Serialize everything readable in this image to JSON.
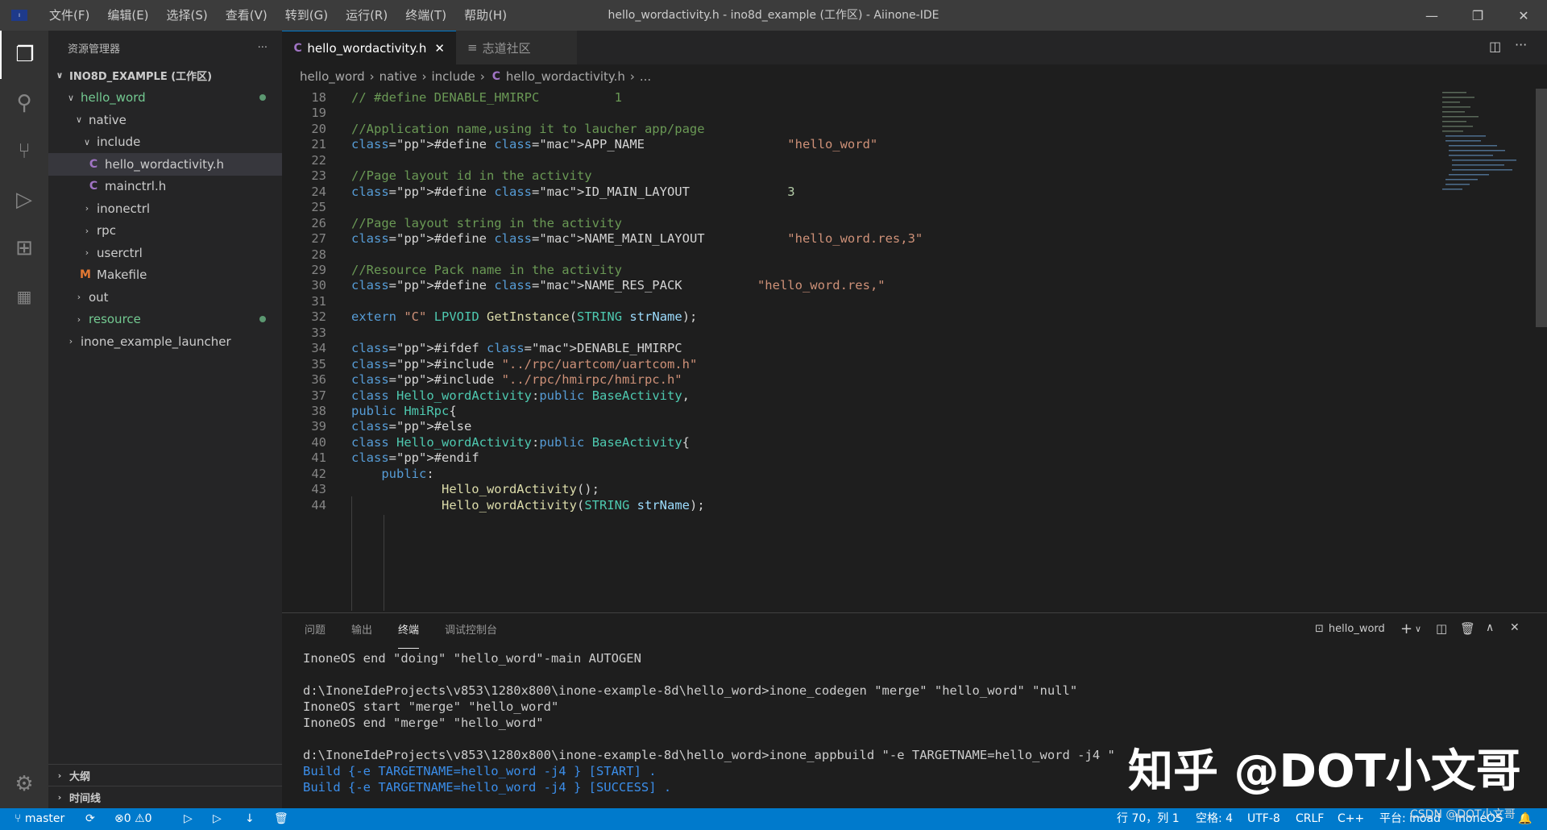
{
  "titlebar": {
    "menu": [
      "文件(F)",
      "编辑(E)",
      "选择(S)",
      "查看(V)",
      "转到(G)",
      "运行(R)",
      "终端(T)",
      "帮助(H)"
    ],
    "window_title": "hello_wordactivity.h - ino8d_example (工作区) - Aiinone-IDE"
  },
  "sidebar": {
    "title": "资源管理器",
    "more": "···",
    "workspace": "INO8D_EXAMPLE (工作区)",
    "items": [
      "hello_word",
      "native",
      "include",
      "hello_wordactivity.h",
      "mainctrl.h",
      "inonectrl",
      "rpc",
      "userctrl",
      "Makefile",
      "out",
      "resource",
      "inone_example_launcher"
    ],
    "outline": "大纲",
    "timeline": "时间线"
  },
  "tabs": {
    "active": "hello_wordactivity.h",
    "second": "志道社区"
  },
  "breadcrumb": [
    "hello_word",
    "native",
    "include",
    "hello_wordactivity.h",
    "..."
  ],
  "code": {
    "lines": [
      {
        "n": "18",
        "t": "// #define DENABLE_HMIRPC          1"
      },
      {
        "n": "19",
        "t": ""
      },
      {
        "n": "20",
        "t": "//Application name,using it to laucher app/page"
      },
      {
        "n": "21",
        "t": "#define APP_NAME                   \"hello_word\""
      },
      {
        "n": "22",
        "t": ""
      },
      {
        "n": "23",
        "t": "//Page layout id in the activity"
      },
      {
        "n": "24",
        "t": "#define ID_MAIN_LAYOUT             3"
      },
      {
        "n": "25",
        "t": ""
      },
      {
        "n": "26",
        "t": "//Page layout string in the activity"
      },
      {
        "n": "27",
        "t": "#define NAME_MAIN_LAYOUT           \"hello_word.res,3\""
      },
      {
        "n": "28",
        "t": ""
      },
      {
        "n": "29",
        "t": "//Resource Pack name in the activity"
      },
      {
        "n": "30",
        "t": "#define NAME_RES_PACK          \"hello_word.res,\""
      },
      {
        "n": "31",
        "t": ""
      },
      {
        "n": "32",
        "t": "extern \"C\" LPVOID GetInstance(STRING strName);"
      },
      {
        "n": "33",
        "t": ""
      },
      {
        "n": "34",
        "t": "#ifdef DENABLE_HMIRPC"
      },
      {
        "n": "35",
        "t": "#include \"../rpc/uartcom/uartcom.h\""
      },
      {
        "n": "36",
        "t": "#include \"../rpc/hmirpc/hmirpc.h\""
      },
      {
        "n": "37",
        "t": "class Hello_wordActivity:public BaseActivity,"
      },
      {
        "n": "38",
        "t": "public HmiRpc{"
      },
      {
        "n": "39",
        "t": "#else"
      },
      {
        "n": "40",
        "t": "class Hello_wordActivity:public BaseActivity{"
      },
      {
        "n": "41",
        "t": "#endif"
      },
      {
        "n": "42",
        "t": "    public:"
      },
      {
        "n": "43",
        "t": "            Hello_wordActivity();"
      },
      {
        "n": "44",
        "t": "            Hello_wordActivity(STRING strName);"
      }
    ]
  },
  "panel": {
    "tabs": [
      "问题",
      "输出",
      "终端",
      "调试控制台"
    ],
    "terminal_name": "hello_word",
    "lines": [
      "InoneOS end \"doing\" \"hello_word\"-main AUTOGEN",
      "",
      "d:\\InoneIdeProjects\\v853\\1280x800\\inone-example-8d\\hello_word>inone_codegen \"merge\" \"hello_word\" \"null\"",
      "InoneOS start \"merge\" \"hello_word\"",
      "InoneOS end \"merge\" \"hello_word\"",
      "",
      "d:\\InoneIdeProjects\\v853\\1280x800\\inone-example-8d\\hello_word>inone_appbuild \"-e TARGETNAME=hello_word -j4 \"",
      "Build {-e TARGETNAME=hello_word -j4 } [START] .",
      "Build {-e TARGETNAME=hello_word -j4 } [SUCCESS] ."
    ]
  },
  "statusbar": {
    "branch": "master",
    "errors": "0",
    "warnings": "0",
    "position": "行 70，列 1",
    "spaces": "空格: 4",
    "encoding": "UTF-8",
    "eol": "CRLF",
    "lang": "C++",
    "platform": "平台: inoad",
    "os": "InoneOS"
  },
  "watermark": {
    "main": "知乎 @DOT小文哥",
    "small": "CSDN @DOT小文哥"
  },
  "colors": {
    "accent": "#007acc",
    "activity": "#333333",
    "sidebar": "#252526",
    "editor": "#1e1e1e"
  }
}
